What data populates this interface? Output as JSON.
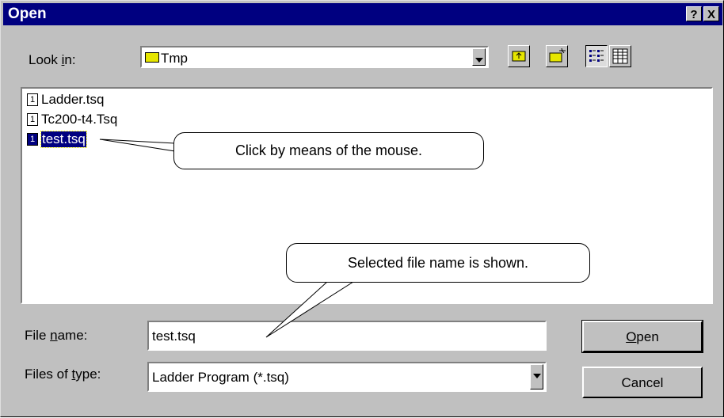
{
  "window": {
    "title": "Open",
    "help_label": "?",
    "close_label": "X"
  },
  "look_in": {
    "label_pre": "Look ",
    "label_u": "i",
    "label_post": "n:",
    "value": "Tmp"
  },
  "files": [
    {
      "name": "Ladder.tsq",
      "selected": false
    },
    {
      "name": "Tc200-t4.Tsq",
      "selected": false
    },
    {
      "name": "test.tsq",
      "selected": true
    }
  ],
  "file_name": {
    "label_pre": "File ",
    "label_u": "n",
    "label_post": "ame:",
    "value": "test.tsq"
  },
  "file_type": {
    "label_pre": "Files of ",
    "label_u": "t",
    "label_post": "ype:",
    "value": "Ladder Program (*.tsq)"
  },
  "buttons": {
    "open_u": "O",
    "open_rest": "pen",
    "cancel": "Cancel"
  },
  "callouts": {
    "click": "Click by means of the mouse.",
    "selected": "Selected file name is shown."
  },
  "colors": {
    "titlebar": "#000080",
    "face": "#c0c0c0",
    "selection": "#000080"
  }
}
